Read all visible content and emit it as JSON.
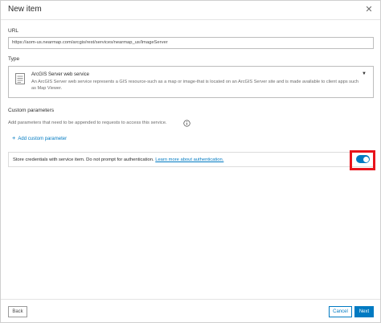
{
  "dialog": {
    "title": "New item",
    "close_icon": "close-icon"
  },
  "url": {
    "label": "URL",
    "value": "https://aom-us.nearmap.com/arcgis/rest/services/nearmap_us/ImageServer"
  },
  "type": {
    "label": "Type",
    "selected_name": "ArcGIS Server web service",
    "selected_description": "An ArcGIS Server web service represents a GIS resource-such as a map or image-that is located on an ArcGIS Server site and is made available to client apps such as Map Viewer.",
    "icon": "document-icon",
    "arrow_icon": "chevron-down-icon"
  },
  "custom_parameters": {
    "label": "Custom parameters",
    "hint": "Add parameters that need to be appended to requests to access this service.",
    "info_icon": "info-icon",
    "add_label": "Add custom parameter",
    "add_icon": "plus-icon"
  },
  "credentials": {
    "text": "Store credentials with service item. Do not prompt for authentication.",
    "link": "Learn more about authentication.",
    "toggle_on": true,
    "highlight_color": "#e8141c"
  },
  "footer": {
    "back_label": "Back",
    "cancel_label": "Cancel",
    "next_label": "Next"
  },
  "colors": {
    "accent": "#007ac2"
  }
}
